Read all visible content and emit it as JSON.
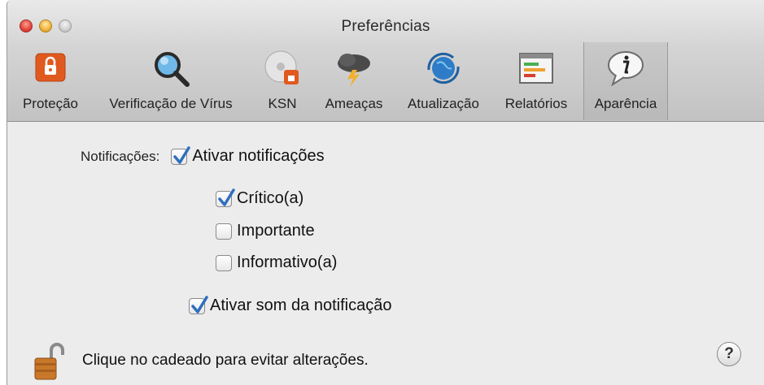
{
  "window": {
    "title": "Preferências"
  },
  "toolbar": {
    "items": [
      {
        "label": "Proteção",
        "icon": "shield-lock-icon"
      },
      {
        "label": "Verificação de Vírus",
        "icon": "magnifier-icon"
      },
      {
        "label": "KSN",
        "icon": "disc-shield-icon"
      },
      {
        "label": "Ameaças",
        "icon": "storm-cloud-icon"
      },
      {
        "label": "Atualização",
        "icon": "globe-sync-icon"
      },
      {
        "label": "Relatórios",
        "icon": "report-icon"
      },
      {
        "label": "Aparência",
        "icon": "info-speech-icon",
        "selected": true
      }
    ]
  },
  "notifications": {
    "section_label": "Notificações:",
    "enable_label": "Ativar notificações",
    "enable_checked": true,
    "levels": [
      {
        "label": "Crítico(a)",
        "checked": true
      },
      {
        "label": "Importante",
        "checked": false
      },
      {
        "label": "Informativo(a)",
        "checked": false
      }
    ],
    "sound_label": "Ativar som da notificação",
    "sound_checked": true
  },
  "footer": {
    "lock_text": "Clique no cadeado para evitar alterações.",
    "help_label": "?"
  },
  "colors": {
    "checkmark": "#2f6fbf",
    "accent_orange": "#e05a1f"
  }
}
